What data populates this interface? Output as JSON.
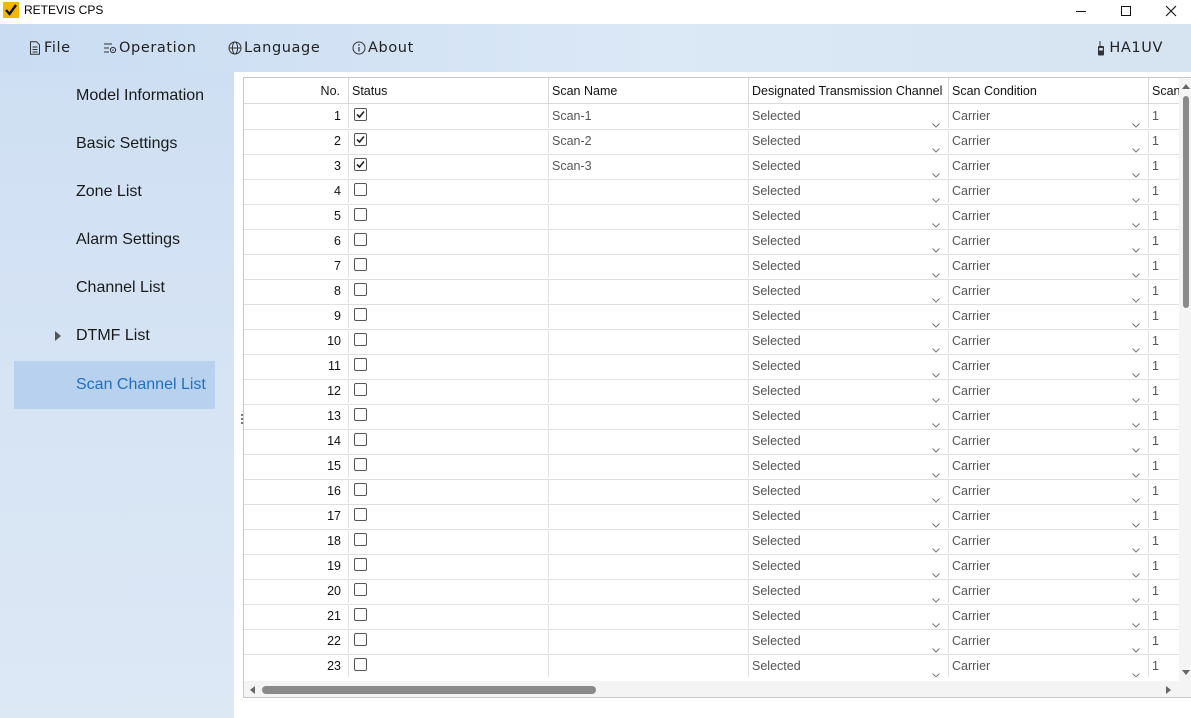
{
  "window": {
    "title": "RETEVIS CPS",
    "logo_icon": "checkmark-logo",
    "accent": "#1f6fbf",
    "logo_bg": "#f0b800"
  },
  "menu": {
    "file": "File",
    "operation": "Operation",
    "language": "Language",
    "about": "About",
    "device": "HA1UV"
  },
  "sidebar": {
    "items": [
      {
        "label": "Model Information"
      },
      {
        "label": "Basic Settings"
      },
      {
        "label": "Zone List"
      },
      {
        "label": "Alarm Settings"
      },
      {
        "label": "Channel List"
      },
      {
        "label": "DTMF List"
      },
      {
        "label": "Scan Channel List"
      }
    ],
    "active_index": 6
  },
  "table": {
    "headers": {
      "no": "No.",
      "status": "Status",
      "scan_name": "Scan Name",
      "designated_tx_channel": "Designated Transmission Channel",
      "scan_condition": "Scan Condition",
      "last": "Scan"
    },
    "rows": [
      {
        "no": "1",
        "checked": true,
        "name": "Scan-1",
        "tx": "Selected",
        "cond": "Carrier",
        "last": "1"
      },
      {
        "no": "2",
        "checked": true,
        "name": "Scan-2",
        "tx": "Selected",
        "cond": "Carrier",
        "last": "1"
      },
      {
        "no": "3",
        "checked": true,
        "name": "Scan-3",
        "tx": "Selected",
        "cond": "Carrier",
        "last": "1"
      },
      {
        "no": "4",
        "checked": false,
        "name": "",
        "tx": "Selected",
        "cond": "Carrier",
        "last": "1"
      },
      {
        "no": "5",
        "checked": false,
        "name": "",
        "tx": "Selected",
        "cond": "Carrier",
        "last": "1"
      },
      {
        "no": "6",
        "checked": false,
        "name": "",
        "tx": "Selected",
        "cond": "Carrier",
        "last": "1"
      },
      {
        "no": "7",
        "checked": false,
        "name": "",
        "tx": "Selected",
        "cond": "Carrier",
        "last": "1"
      },
      {
        "no": "8",
        "checked": false,
        "name": "",
        "tx": "Selected",
        "cond": "Carrier",
        "last": "1"
      },
      {
        "no": "9",
        "checked": false,
        "name": "",
        "tx": "Selected",
        "cond": "Carrier",
        "last": "1"
      },
      {
        "no": "10",
        "checked": false,
        "name": "",
        "tx": "Selected",
        "cond": "Carrier",
        "last": "1"
      },
      {
        "no": "11",
        "checked": false,
        "name": "",
        "tx": "Selected",
        "cond": "Carrier",
        "last": "1"
      },
      {
        "no": "12",
        "checked": false,
        "name": "",
        "tx": "Selected",
        "cond": "Carrier",
        "last": "1"
      },
      {
        "no": "13",
        "checked": false,
        "name": "",
        "tx": "Selected",
        "cond": "Carrier",
        "last": "1"
      },
      {
        "no": "14",
        "checked": false,
        "name": "",
        "tx": "Selected",
        "cond": "Carrier",
        "last": "1"
      },
      {
        "no": "15",
        "checked": false,
        "name": "",
        "tx": "Selected",
        "cond": "Carrier",
        "last": "1"
      },
      {
        "no": "16",
        "checked": false,
        "name": "",
        "tx": "Selected",
        "cond": "Carrier",
        "last": "1"
      },
      {
        "no": "17",
        "checked": false,
        "name": "",
        "tx": "Selected",
        "cond": "Carrier",
        "last": "1"
      },
      {
        "no": "18",
        "checked": false,
        "name": "",
        "tx": "Selected",
        "cond": "Carrier",
        "last": "1"
      },
      {
        "no": "19",
        "checked": false,
        "name": "",
        "tx": "Selected",
        "cond": "Carrier",
        "last": "1"
      },
      {
        "no": "20",
        "checked": false,
        "name": "",
        "tx": "Selected",
        "cond": "Carrier",
        "last": "1"
      },
      {
        "no": "21",
        "checked": false,
        "name": "",
        "tx": "Selected",
        "cond": "Carrier",
        "last": "1"
      },
      {
        "no": "22",
        "checked": false,
        "name": "",
        "tx": "Selected",
        "cond": "Carrier",
        "last": "1"
      },
      {
        "no": "23",
        "checked": false,
        "name": "",
        "tx": "Selected",
        "cond": "Carrier",
        "last": "1"
      }
    ]
  }
}
